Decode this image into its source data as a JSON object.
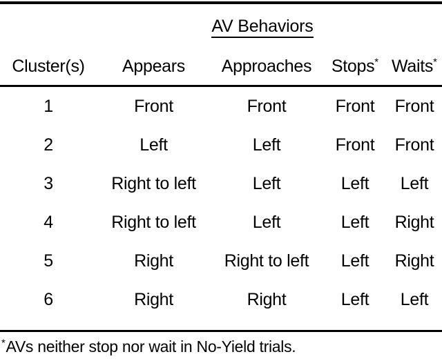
{
  "figure": {
    "group_header": "AV Behaviors",
    "footnote_marker": "*",
    "footnote_text": "AVs  neither stop nor wait in No-Yield trials."
  },
  "table": {
    "columns": [
      {
        "key": "cluster",
        "label": "Cluster(s)",
        "marker": ""
      },
      {
        "key": "appears",
        "label": "Appears",
        "marker": ""
      },
      {
        "key": "approaches",
        "label": "Approaches",
        "marker": ""
      },
      {
        "key": "stops",
        "label": "Stops",
        "marker": "*"
      },
      {
        "key": "waits",
        "label": "Waits",
        "marker": "*"
      }
    ],
    "rows": [
      {
        "cluster": "1",
        "appears": "Front",
        "approaches": "Front",
        "stops": "Front",
        "waits": "Front"
      },
      {
        "cluster": "2",
        "appears": "Left",
        "approaches": "Left",
        "stops": "Front",
        "waits": "Front"
      },
      {
        "cluster": "3",
        "appears": "Right to left",
        "approaches": "Left",
        "stops": "Left",
        "waits": "Left"
      },
      {
        "cluster": "4",
        "appears": "Right to left",
        "approaches": "Left",
        "stops": "Left",
        "waits": "Right"
      },
      {
        "cluster": "5",
        "appears": "Right",
        "approaches": "Right to left",
        "stops": "Left",
        "waits": "Right"
      },
      {
        "cluster": "6",
        "appears": "Right",
        "approaches": "Right",
        "stops": "Left",
        "waits": "Left"
      }
    ]
  },
  "style": {
    "text_color": "#000000",
    "background_color": "#ffffff",
    "rule_color": "#000000"
  }
}
